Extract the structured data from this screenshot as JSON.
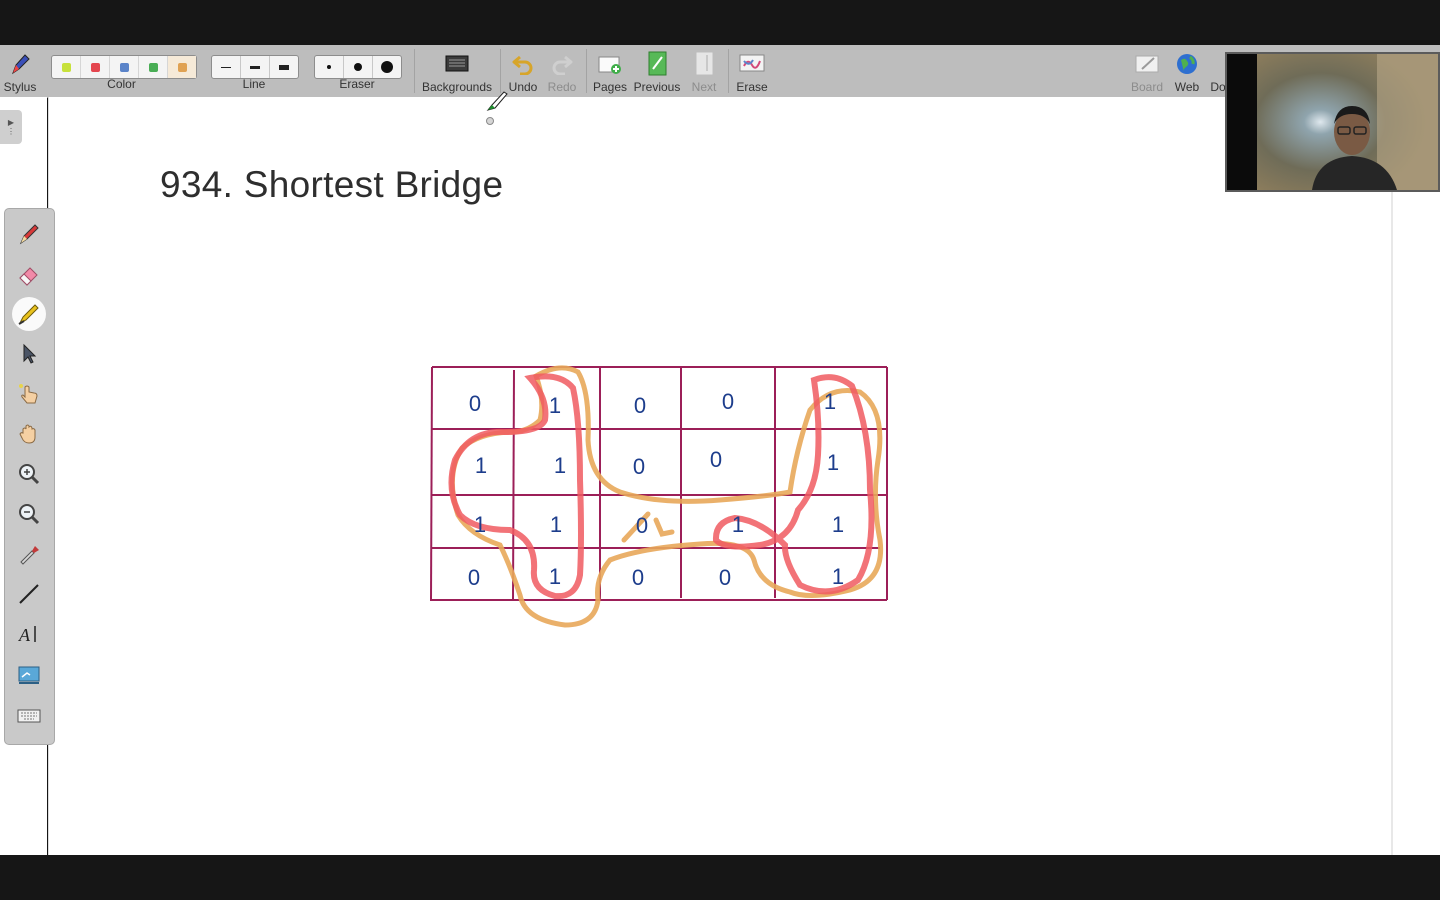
{
  "toolbar": {
    "stylus_label": "Stylus",
    "color_label": "Color",
    "line_label": "Line",
    "eraser_label": "Eraser",
    "backgrounds_label": "Backgrounds",
    "undo_label": "Undo",
    "redo_label": "Redo",
    "pages_label": "Pages",
    "previous_label": "Previous",
    "next_label": "Next",
    "erase_label": "Erase",
    "board_label": "Board",
    "web_label": "Web",
    "doc_label": "Do"
  },
  "colors": [
    "#c7e13a",
    "#e4464f",
    "#5b84c9",
    "#49ad55",
    "#e0a253"
  ],
  "line_widths": [
    "thin",
    "medium",
    "thick"
  ],
  "eraser_sizes": [
    "small",
    "medium",
    "large"
  ],
  "page": {
    "title": "934. Shortest Bridge"
  },
  "grid": {
    "rows": [
      [
        "0",
        "1",
        "0",
        "0",
        "1"
      ],
      [
        "1",
        "1",
        "0",
        "0",
        "1"
      ],
      [
        "1",
        "1",
        "0",
        "1",
        "1"
      ],
      [
        "0",
        "1",
        "0",
        "0",
        "1"
      ]
    ],
    "line_color": "#9c1f58",
    "digit_color": "#1d3d8c",
    "island_stroke_red": "#f05a60",
    "island_stroke_orange": "#e8a85a"
  },
  "side_tools": [
    "pen-icon",
    "eraser-icon",
    "highlighter-icon",
    "select-arrow-icon",
    "pointer-hand-icon",
    "pan-hand-icon",
    "zoom-in-icon",
    "zoom-out-icon",
    "dropper-icon",
    "line-icon",
    "text-icon",
    "screen-capture-icon",
    "keyboard-icon"
  ]
}
